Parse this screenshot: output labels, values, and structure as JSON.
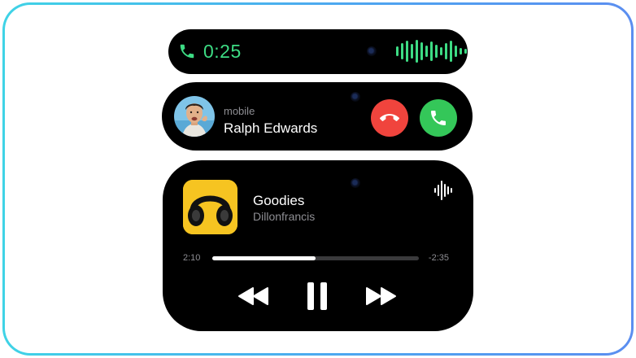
{
  "active_call": {
    "elapsed": "0:25",
    "accent_color": "#3ddc84",
    "icons": [
      "phone-icon",
      "voice-wave-icon"
    ]
  },
  "incoming_call": {
    "subtitle": "mobile",
    "caller_name": "Ralph Edwards",
    "decline_color": "#f0443d",
    "accept_color": "#34c759",
    "icons": [
      "caller-avatar",
      "decline-call-icon",
      "accept-call-icon"
    ]
  },
  "now_playing": {
    "title": "Goodies",
    "artist": "Dillonfrancis",
    "elapsed": "2:10",
    "remaining": "-2:35",
    "progress": 0.5,
    "icons": [
      "headphones-album-art",
      "audio-waveform-icon",
      "rewind-icon",
      "pause-icon",
      "fast-forward-icon"
    ]
  }
}
